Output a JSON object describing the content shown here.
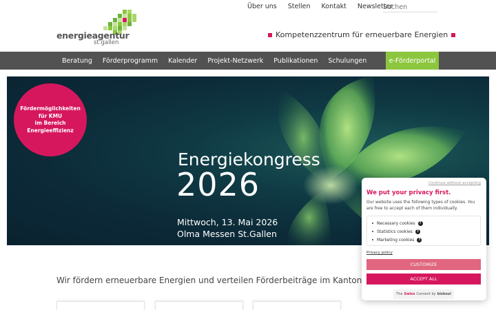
{
  "logo": {
    "name": "energieagentur",
    "sub": "st.gallen",
    "mosaic_color": "#8cc63f",
    "accent_color": "#d6175e"
  },
  "topnav": {
    "links": [
      "Über uns",
      "Stellen",
      "Kontakt",
      "Newsletter"
    ],
    "search_placeholder": "Suchen"
  },
  "tagline": "Kompetenzzentrum für erneuerbare Energien",
  "mainnav": {
    "items": [
      "Beratung",
      "Förderprogramm",
      "Kalender",
      "Projekt-Netzwerk",
      "Publikationen",
      "Schulungen"
    ],
    "portal": "e-Förderportal"
  },
  "badge": {
    "lines": [
      "Fördermöglichkeiten",
      "für KMU",
      "im Bereich",
      "Energieeffizienz"
    ]
  },
  "hero": {
    "title": "Energiekongress",
    "year": "2026",
    "date": "Mittwoch, 13. Mai 2026",
    "venue": "Olma Messen St.Gallen"
  },
  "intro": "Wir fördern erneuerbare Energien und verteilen Förderbeiträge im Kanton St.Gal",
  "consent": {
    "skip": "Continue without accepting",
    "title": "We put your privacy first.",
    "text": "Our website uses the following types of cookies. You are free to accept each of them individually.",
    "categories": [
      "Necessary cookies",
      "Statistics cookies",
      "Marketing cookies"
    ],
    "policy": "Privacy policy",
    "customize": "CUSTOMIZE",
    "accept": "ACCEPT ALL",
    "footer_prefix": "The",
    "footer_brand": "Swiss",
    "footer_mid": "Consent by",
    "footer_vendor": "biskoui"
  },
  "colors": {
    "brand_green": "#8cc63f",
    "brand_pink": "#d6175e",
    "nav_bg": "#525252"
  }
}
